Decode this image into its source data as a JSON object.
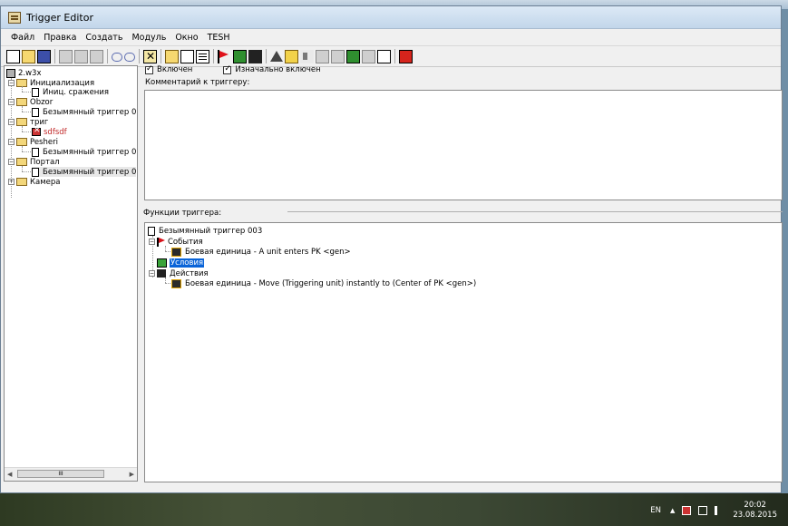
{
  "window": {
    "title": "Trigger Editor"
  },
  "menu": [
    "Файл",
    "Правка",
    "Создать",
    "Модуль",
    "Окно",
    "TESH"
  ],
  "toolbar": {
    "icons": [
      "new-page-icon",
      "open-folder-icon",
      "save-disk-icon",
      "cut-icon",
      "copy-icon",
      "paste-icon",
      "undo-icon",
      "redo-icon",
      "delete-x-icon",
      "new-category-icon",
      "new-trigger-icon",
      "new-comment-icon",
      "event-flag-icon",
      "condition-icon",
      "action-icon",
      "terrain-icon",
      "unit-icon",
      "sound-icon",
      "ai-icon",
      "object-icon",
      "import-icon",
      "script-icon",
      "test-map-icon"
    ]
  },
  "tree": {
    "root": "2.w3x",
    "items": [
      {
        "label": "Инициализация",
        "kind": "folder"
      },
      {
        "label": "Иниц. сражения",
        "kind": "trigger"
      },
      {
        "label": "Obzor",
        "kind": "folder"
      },
      {
        "label": "Безымянный триггер 0",
        "kind": "trigger"
      },
      {
        "label": "триг",
        "kind": "folder"
      },
      {
        "label": "sdfsdf",
        "kind": "disabled-trigger"
      },
      {
        "label": "Pesheri",
        "kind": "folder"
      },
      {
        "label": "Безымянный триггер 0",
        "kind": "trigger"
      },
      {
        "label": "Портал",
        "kind": "folder"
      },
      {
        "label": "Безымянный триггер 0",
        "kind": "trigger"
      },
      {
        "label": "Камера",
        "kind": "folder"
      }
    ],
    "scroll_thumb_text": "III"
  },
  "trigger": {
    "enabled_label": "Включен",
    "initially_on_label": "Изначально включен",
    "comment_label": "Комментарий к триггеру:",
    "functions_label": "Функции триггера:",
    "name": "Безымянный триггер 003",
    "events_label": "События",
    "event_1": "Боевая единица - A unit enters PK <gen>",
    "conditions_label": "Условия",
    "actions_label": "Действия",
    "action_1": "Боевая единица - Move (Triggering unit) instantly to (Center of PK <gen>)"
  },
  "tray": {
    "lang": "EN",
    "time": "20:02",
    "date": "23.08.2015"
  }
}
